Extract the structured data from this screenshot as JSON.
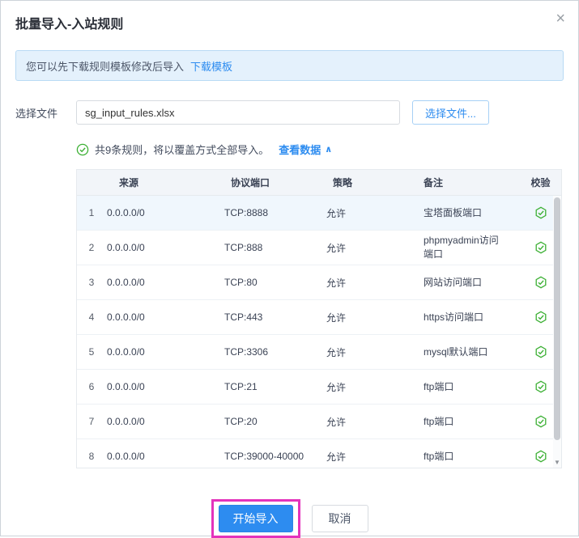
{
  "dialog": {
    "title": "批量导入-入站规则",
    "close_icon": "×"
  },
  "banner": {
    "text": "您可以先下载规则模板修改后导入",
    "link": "下载模板"
  },
  "file_select": {
    "label": "选择文件",
    "value": "sg_input_rules.xlsx",
    "button": "选择文件..."
  },
  "status": {
    "text": "共9条规则，将以覆盖方式全部导入。",
    "link": "查看数据",
    "caret": "∧"
  },
  "table": {
    "headers": [
      "",
      "来源",
      "协议端口",
      "策略",
      "备注",
      "校验"
    ],
    "rows": [
      {
        "index": "1",
        "source": "0.0.0.0/0",
        "protocol_port": "TCP:8888",
        "policy": "允许",
        "remark": "宝塔面板端口"
      },
      {
        "index": "2",
        "source": "0.0.0.0/0",
        "protocol_port": "TCP:888",
        "policy": "允许",
        "remark": "phpmyadmin访问端口"
      },
      {
        "index": "3",
        "source": "0.0.0.0/0",
        "protocol_port": "TCP:80",
        "policy": "允许",
        "remark": "网站访问端口"
      },
      {
        "index": "4",
        "source": "0.0.0.0/0",
        "protocol_port": "TCP:443",
        "policy": "允许",
        "remark": "https访问端口"
      },
      {
        "index": "5",
        "source": "0.0.0.0/0",
        "protocol_port": "TCP:3306",
        "policy": "允许",
        "remark": "mysql默认端口"
      },
      {
        "index": "6",
        "source": "0.0.0.0/0",
        "protocol_port": "TCP:21",
        "policy": "允许",
        "remark": "ftp端口"
      },
      {
        "index": "7",
        "source": "0.0.0.0/0",
        "protocol_port": "TCP:20",
        "policy": "允许",
        "remark": "ftp端口"
      },
      {
        "index": "8",
        "source": "0.0.0.0/0",
        "protocol_port": "TCP:39000-40000",
        "policy": "允许",
        "remark": "ftp端口"
      }
    ]
  },
  "footer": {
    "confirm": "开始导入",
    "cancel": "取消"
  },
  "colors": {
    "accent_blue": "#2d8cf0",
    "success_green": "#3cb034",
    "annotation_magenta": "#e433bc",
    "banner_bg": "#e4f1fc",
    "table_header_bg": "#f2f5f9"
  }
}
